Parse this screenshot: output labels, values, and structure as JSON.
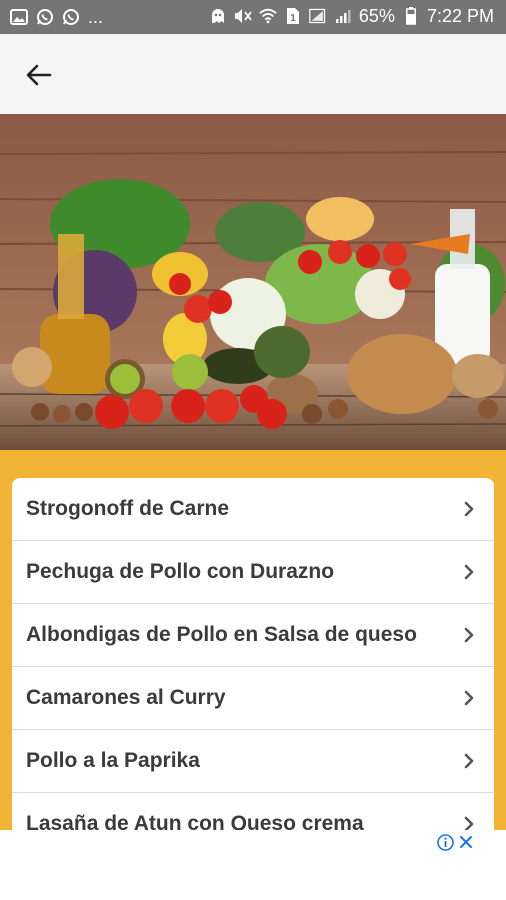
{
  "status_bar": {
    "battery": "65%",
    "time": "7:22 PM",
    "dots": "...",
    "left_icons": [
      "gallery-icon",
      "whatsapp-icon",
      "whatsapp-icon"
    ],
    "right_icons": [
      "ghost-icon",
      "mute-icon",
      "wifi-icon",
      "sim-icon",
      "signal-icon",
      "battery-icon"
    ]
  },
  "app_bar": {
    "back_icon": "arrow-left-icon"
  },
  "recipes": {
    "items": [
      {
        "label": "Strogonoff de Carne"
      },
      {
        "label": "Pechuga de Pollo con Durazno"
      },
      {
        "label": "Albondigas de Pollo en Salsa de queso"
      },
      {
        "label": "Camarones al Curry"
      },
      {
        "label": "Pollo a la Paprika"
      },
      {
        "label": "Lasaña de Atun con Queso crema"
      }
    ]
  },
  "colors": {
    "accent": "#f2b437",
    "status_bar": "#757575",
    "app_bar": "#f5f5f5",
    "text": "#3b3b3b",
    "ad_icon": "#1a73e8"
  }
}
